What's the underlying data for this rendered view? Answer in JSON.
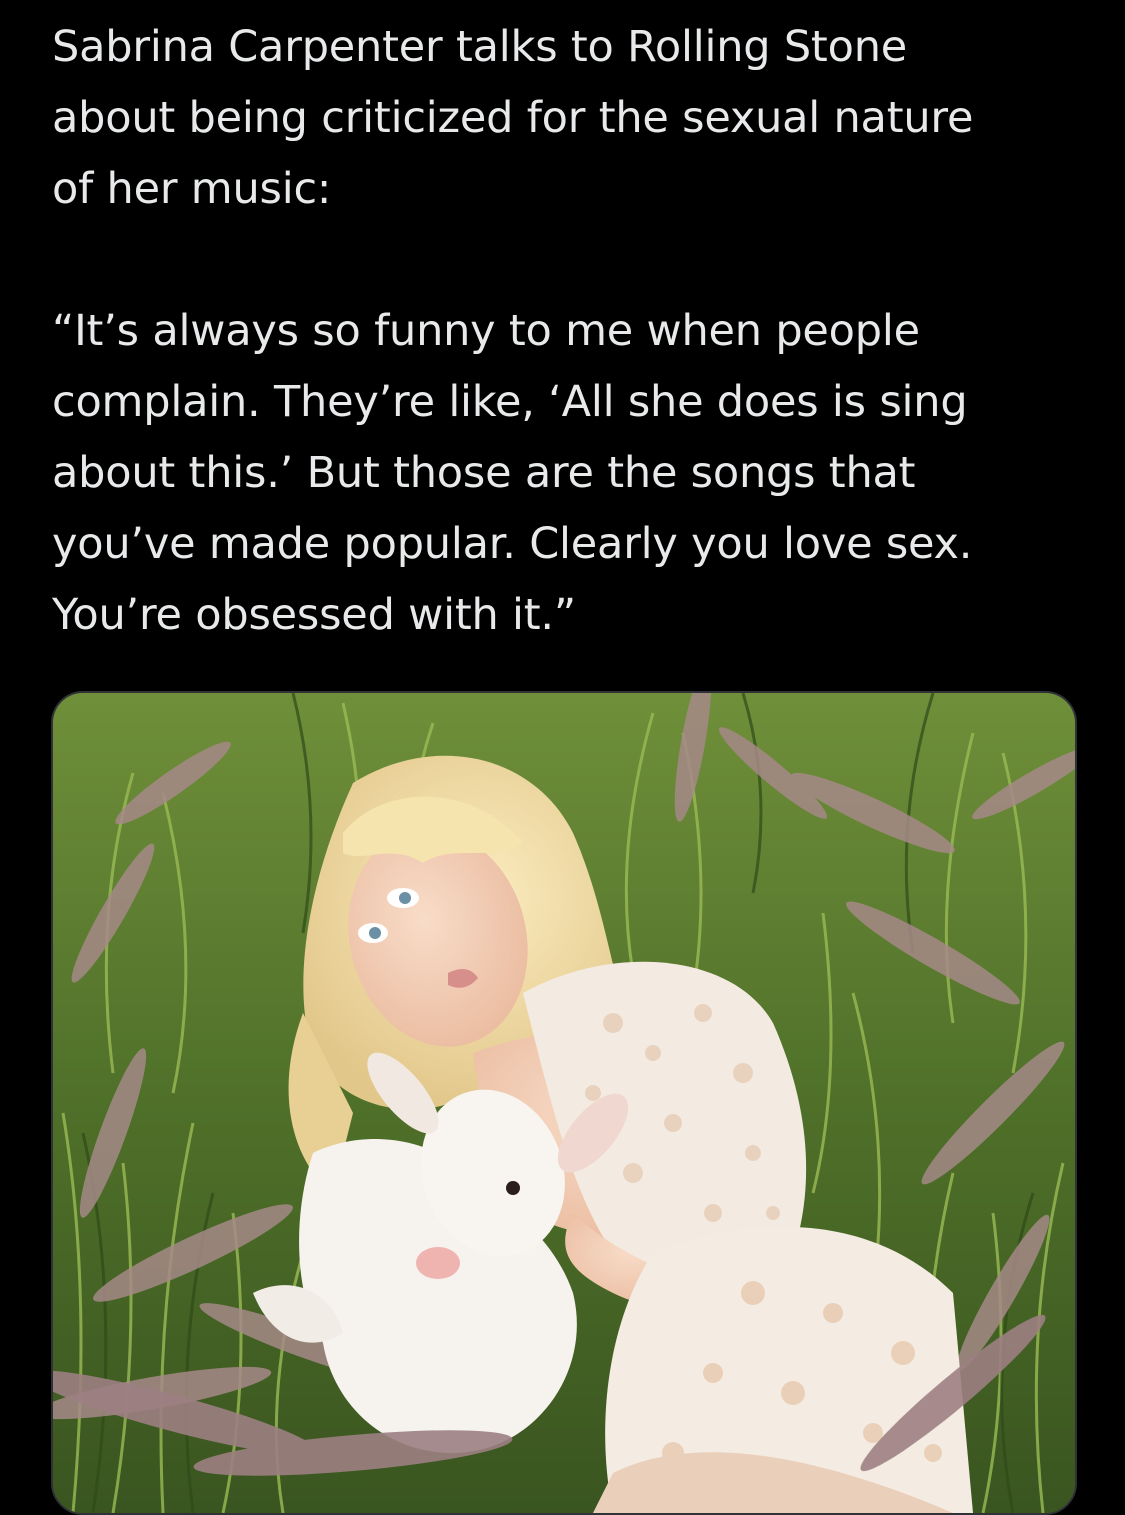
{
  "post": {
    "intro_lines": [
      "Sabrina Carpenter talks to Rolling Stone",
      "about being criticized for the sexual nature",
      "of her music:"
    ],
    "quote_lines": [
      "“It’s always so funny to me when people",
      "complain. They’re like, ‘All she does is sing",
      "about this.’ But those are the songs that",
      "you’ve made popular. Clearly you love sex.",
      "You’re obsessed with it.”"
    ]
  },
  "media": {
    "subject": "photo-woman-with-lamb-in-grass",
    "colors": {
      "grass_dark": "#3d5a22",
      "grass_light": "#8fae4a",
      "plume": "#a58a8c",
      "hair": "#f1dca0",
      "skin": "#f3cdb4",
      "lace": "#f4ece2",
      "lamb": "#f6f2ee"
    }
  },
  "theme": {
    "background": "#000000",
    "text": "#e7e9ea",
    "border": "#2f3336"
  }
}
